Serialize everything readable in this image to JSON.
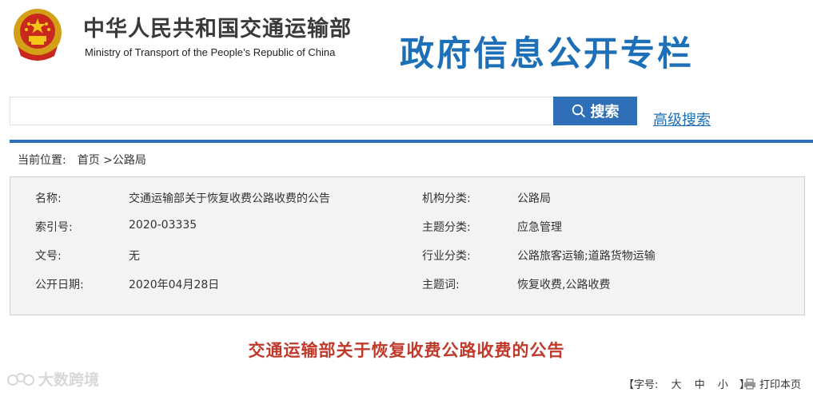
{
  "header": {
    "ministry_cn": "中华人民共和国交通运输部",
    "ministry_en": "Ministry of Transport of the People’s Republic of China",
    "section_title": "政府信息公开专栏"
  },
  "search": {
    "placeholder": "",
    "button_label": "搜索",
    "advanced_label": "高级搜索"
  },
  "breadcrumb": {
    "prefix": "当前位置:",
    "home": "首页",
    "current": ">公路局"
  },
  "info": {
    "rows": [
      {
        "label": "名称:",
        "value": "交通运输部关于恢复收费公路收费的公告",
        "label2": "机构分类:",
        "value2": "公路局"
      },
      {
        "label": "索引号:",
        "value": "2020-03335",
        "label2": "主题分类:",
        "value2": "应急管理"
      },
      {
        "label": "文号:",
        "value": "无",
        "label2": "行业分类:",
        "value2": "公路旅客运输;道路货物运输"
      },
      {
        "label": "公开日期:",
        "value": "2020年04月28日",
        "label2": "主题词:",
        "value2": "恢复收费,公路收费"
      }
    ]
  },
  "document": {
    "title": "交通运输部关于恢复收费公路收费的公告"
  },
  "watermark": {
    "text": "大数跨境"
  },
  "tools": {
    "font_label": "【字号:",
    "large": "大",
    "medium": "中",
    "small": "小",
    "font_close": "】",
    "print_label": "打印本页"
  },
  "colors": {
    "brand_blue": "#1d6fb7",
    "search_button": "#2e6fb7",
    "title_red": "#c0392b"
  }
}
